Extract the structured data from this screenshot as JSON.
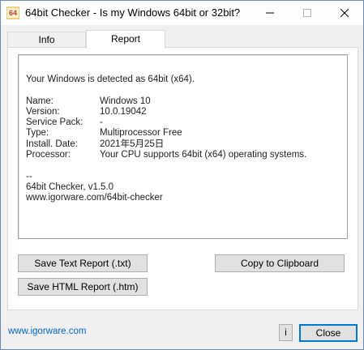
{
  "window": {
    "title": "64bit Checker - Is my Windows 64bit or 32bit?",
    "app_icon_text": "64"
  },
  "tabs": [
    {
      "label": "Info",
      "selected": false
    },
    {
      "label": "Report",
      "selected": true
    }
  ],
  "report": {
    "detected_line": "Your Windows is detected as 64bit (x64).",
    "fields": [
      {
        "key": "Name:",
        "value": "Windows 10"
      },
      {
        "key": "Version:",
        "value": "10.0.19042"
      },
      {
        "key": "Service Pack:",
        "value": "-"
      },
      {
        "key": "Type:",
        "value": "Multiprocessor Free"
      },
      {
        "key": "Install. Date:",
        "value": "2021年5月25日"
      },
      {
        "key": "Processor:",
        "value": "Your CPU supports 64bit (x64) operating systems."
      }
    ],
    "separator": "--",
    "app_version": "64bit Checker, v1.5.0",
    "app_url": "www.igorware.com/64bit-checker"
  },
  "buttons": {
    "save_text": "Save Text Report (.txt)",
    "save_html": "Save HTML Report (.htm)",
    "copy": "Copy to Clipboard",
    "info": "i",
    "close": "Close"
  },
  "footer": {
    "link": "www.igorware.com"
  },
  "colors": {
    "accent": "#0078d7",
    "link": "#0066cc",
    "icon_orange": "#e8a317"
  }
}
